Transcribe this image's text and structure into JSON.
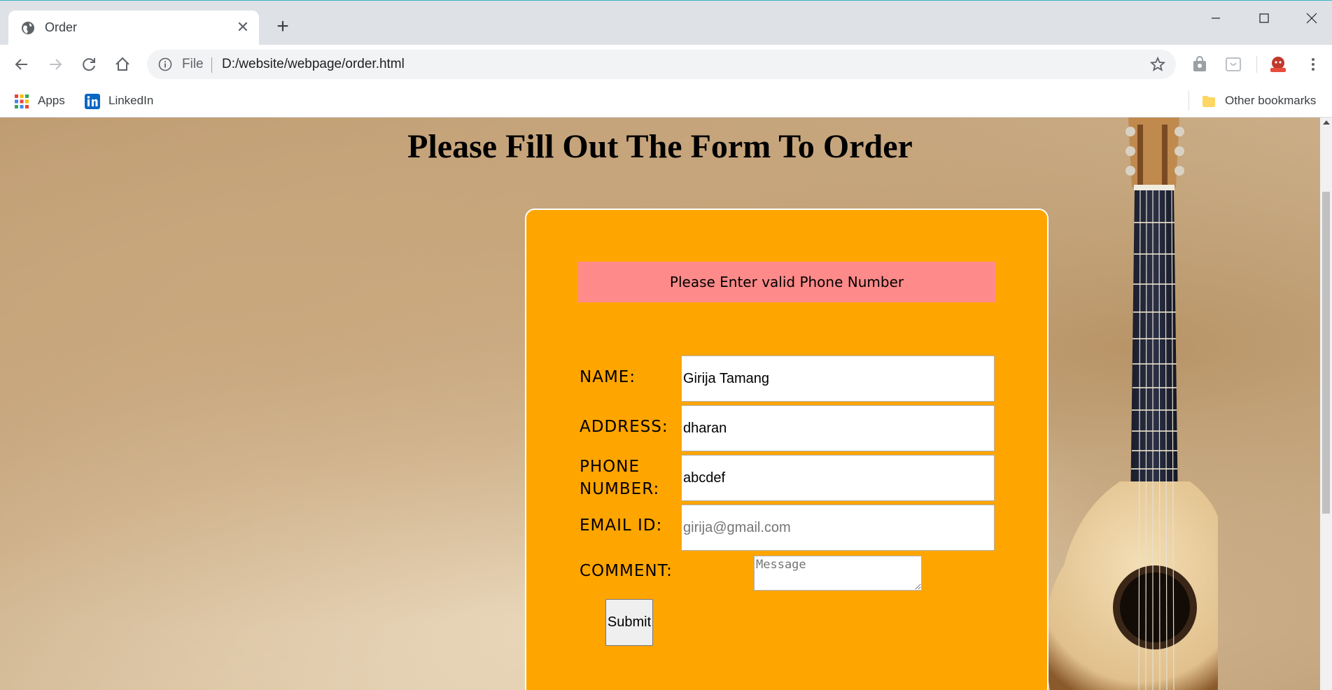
{
  "browser": {
    "tab_title": "Order",
    "address_scheme": "File",
    "url": "D:/website/webpage/order.html",
    "bookmarks": [
      {
        "label": "Apps"
      },
      {
        "label": "LinkedIn"
      }
    ],
    "other_bookmarks": "Other bookmarks"
  },
  "page": {
    "heading": "Please Fill Out The Form To Order",
    "error_message": "Please Enter valid Phone Number",
    "form": {
      "name_label": "NAME:",
      "name_value": "Girija Tamang",
      "address_label": "ADDRESS:",
      "address_value": "dharan",
      "phone_label_line1": "PHONE",
      "phone_label_line2": "NUMBER:",
      "phone_value": "abcdef",
      "email_label": "EMAIL ID:",
      "email_placeholder": "girija@gmail.com",
      "comment_label": "COMMENT:",
      "comment_placeholder": "Message",
      "submit_label": "Submit"
    }
  },
  "colors": {
    "card": "#ffa500",
    "error": "#ff8a8a"
  }
}
